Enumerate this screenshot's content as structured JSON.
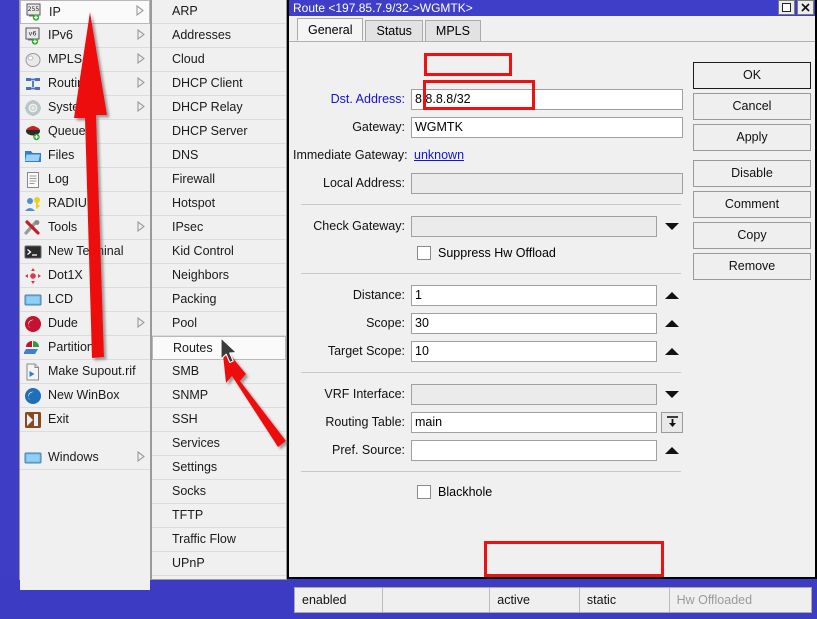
{
  "app": {
    "name": "WinBox",
    "desktop_color": "#3d3dc6"
  },
  "sidebar_menu": {
    "name": "main-menu",
    "items": [
      {
        "label": "IP",
        "icon": "ip-icon",
        "submenu": true,
        "selected": true
      },
      {
        "label": "IPv6",
        "icon": "ipv6-icon",
        "submenu": true
      },
      {
        "label": "MPLS",
        "icon": "mpls-icon",
        "submenu": true
      },
      {
        "label": "Routing",
        "icon": "routing-icon",
        "submenu": true
      },
      {
        "label": "System",
        "icon": "system-icon",
        "submenu": true
      },
      {
        "label": "Queues",
        "icon": "queues-icon",
        "submenu": false
      },
      {
        "label": "Files",
        "icon": "files-icon",
        "submenu": false
      },
      {
        "label": "Log",
        "icon": "log-icon",
        "submenu": false
      },
      {
        "label": "RADIUS",
        "icon": "radius-icon",
        "submenu": false
      },
      {
        "label": "Tools",
        "icon": "tools-icon",
        "submenu": true
      },
      {
        "label": "New Terminal",
        "icon": "terminal-icon",
        "submenu": false
      },
      {
        "label": "Dot1X",
        "icon": "dot1x-icon",
        "submenu": false
      },
      {
        "label": "LCD",
        "icon": "lcd-icon",
        "submenu": false
      },
      {
        "label": "Dude",
        "icon": "dude-icon",
        "submenu": true
      },
      {
        "label": "Partition",
        "icon": "partition-icon",
        "submenu": false
      },
      {
        "label": "Make Supout.rif",
        "icon": "supout-icon",
        "submenu": false
      },
      {
        "label": "New WinBox",
        "icon": "winbox-icon",
        "submenu": false
      },
      {
        "label": "Exit",
        "icon": "exit-icon",
        "submenu": false
      },
      {
        "label": "Windows",
        "icon": "windows-icon",
        "submenu": true
      }
    ]
  },
  "ip_submenu": {
    "name": "ip-submenu",
    "items": [
      {
        "label": "ARP"
      },
      {
        "label": "Addresses"
      },
      {
        "label": "Cloud"
      },
      {
        "label": "DHCP Client"
      },
      {
        "label": "DHCP Relay"
      },
      {
        "label": "DHCP Server"
      },
      {
        "label": "DNS"
      },
      {
        "label": "Firewall"
      },
      {
        "label": "Hotspot"
      },
      {
        "label": "IPsec"
      },
      {
        "label": "Kid Control"
      },
      {
        "label": "Neighbors"
      },
      {
        "label": "Packing"
      },
      {
        "label": "Pool"
      },
      {
        "label": "Routes",
        "selected": true
      },
      {
        "label": "SMB"
      },
      {
        "label": "SNMP"
      },
      {
        "label": "SSH"
      },
      {
        "label": "Services"
      },
      {
        "label": "Settings"
      },
      {
        "label": "Socks"
      },
      {
        "label": "TFTP"
      },
      {
        "label": "Traffic Flow"
      },
      {
        "label": "UPnP"
      }
    ]
  },
  "dialog": {
    "title": "Route <197.85.7.9/32->WGMTK>",
    "window_controls": {
      "maximize": "□",
      "close": "✕"
    },
    "tabs": [
      {
        "label": "General",
        "active": true
      },
      {
        "label": "Status",
        "active": false
      },
      {
        "label": "MPLS",
        "active": false
      }
    ],
    "fields": {
      "dst_address": {
        "label": "Dst. Address:",
        "value": "8.8.8.8/32",
        "highlighted": true
      },
      "gateway": {
        "label": "Gateway:",
        "value": "WGMTK",
        "highlighted": true
      },
      "immediate_gateway": {
        "label": "Immediate Gateway:",
        "value": "unknown"
      },
      "local_address": {
        "label": "Local Address:",
        "value": ""
      },
      "check_gateway": {
        "label": "Check Gateway:",
        "value": ""
      },
      "suppress_hw_offload": {
        "label": "Suppress Hw Offload",
        "checked": false
      },
      "distance": {
        "label": "Distance:",
        "value": "1"
      },
      "scope": {
        "label": "Scope:",
        "value": "30"
      },
      "target_scope": {
        "label": "Target Scope:",
        "value": "10"
      },
      "vrf_interface": {
        "label": "VRF Interface:",
        "value": ""
      },
      "routing_table": {
        "label": "Routing Table:",
        "value": "main"
      },
      "pref_source": {
        "label": "Pref. Source:",
        "value": ""
      },
      "blackhole": {
        "label": "Blackhole",
        "checked": false
      }
    },
    "buttons": [
      {
        "label": "OK",
        "primary": true
      },
      {
        "label": "Cancel",
        "primary": false
      },
      {
        "label": "Apply",
        "primary": false
      },
      {
        "label": "Disable",
        "primary": false,
        "gap": true
      },
      {
        "label": "Comment",
        "primary": false
      },
      {
        "label": "Copy",
        "primary": false
      },
      {
        "label": "Remove",
        "primary": false
      }
    ],
    "status_bar": {
      "cells": [
        {
          "text": "enabled",
          "dim": false
        },
        {
          "text": "",
          "dim": false
        },
        {
          "text": "active",
          "dim": false
        },
        {
          "text": "static",
          "dim": false
        },
        {
          "text": "Hw Offloaded",
          "dim": true
        }
      ]
    }
  },
  "annotations": {
    "color": "#ee1111",
    "highlight_boxes": [
      {
        "name": "dst-address-highlight"
      },
      {
        "name": "gateway-highlight"
      },
      {
        "name": "status-active-static-highlight"
      }
    ],
    "arrows": [
      {
        "name": "arrow-to-ip-menu",
        "points_to": "IP"
      },
      {
        "name": "arrow-to-routes-menu",
        "points_to": "Routes"
      }
    ]
  }
}
